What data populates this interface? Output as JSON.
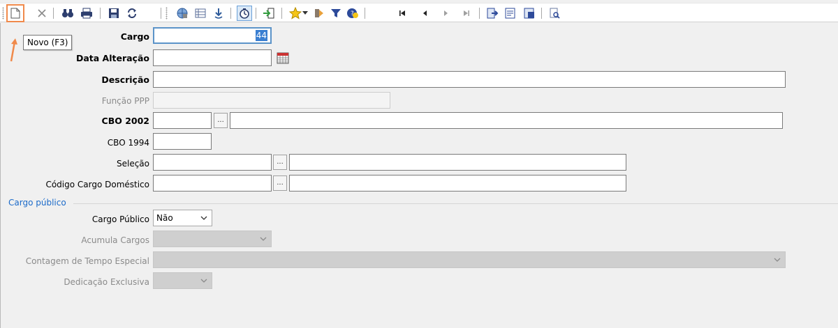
{
  "toolbar": {
    "tooltip": "Novo (F3)",
    "colors": {
      "highlight": "#f08a4b",
      "accent": "#1b6ac9"
    }
  },
  "form": {
    "cargo": {
      "label": "Cargo",
      "value": "44"
    },
    "data_alteracao": {
      "label": "Data Alteração",
      "value": ""
    },
    "descricao": {
      "label": "Descrição",
      "value": ""
    },
    "funcao_ppp": {
      "label": "Função PPP",
      "value": ""
    },
    "cbo_2002": {
      "label": "CBO 2002",
      "value": "",
      "browse": "..."
    },
    "cbo_1994": {
      "label": "CBO 1994",
      "value": ""
    },
    "selecao": {
      "label": "Seleção",
      "value": "",
      "browse": "..."
    },
    "codigo_cargo_domestico": {
      "label": "Código Cargo Doméstico",
      "value": "",
      "browse": "..."
    }
  },
  "cargo_publico_group": {
    "title": "Cargo público",
    "cargo_publico": {
      "label": "Cargo Público",
      "value": "Não"
    },
    "acumula_cargos": {
      "label": "Acumula Cargos",
      "value": ""
    },
    "contagem_tempo_especial": {
      "label": "Contagem de Tempo Especial",
      "value": ""
    },
    "dedicacao_exclusiva": {
      "label": "Dedicação Exclusiva",
      "value": ""
    }
  }
}
